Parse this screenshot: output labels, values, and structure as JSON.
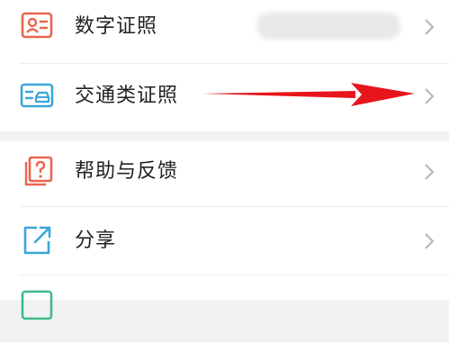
{
  "menu_group_1": {
    "items": [
      {
        "label": "数字证照",
        "icon": "digital-id-card-icon",
        "icon_color": "#e9664f"
      },
      {
        "label": "交通类证照",
        "icon": "vehicle-license-card-icon",
        "icon_color": "#3aa6d9"
      }
    ]
  },
  "menu_group_2": {
    "items": [
      {
        "label": "帮助与反馈",
        "icon": "help-feedback-icon",
        "icon_color": "#e9664f"
      },
      {
        "label": "分享",
        "icon": "share-icon",
        "icon_color": "#3aa6d9"
      }
    ]
  },
  "annotation": {
    "arrow_color": "#e8151c"
  },
  "colors": {
    "background": "#f2f2f4",
    "card": "#ffffff",
    "chevron": "#b5b5b8",
    "text": "#222222"
  }
}
